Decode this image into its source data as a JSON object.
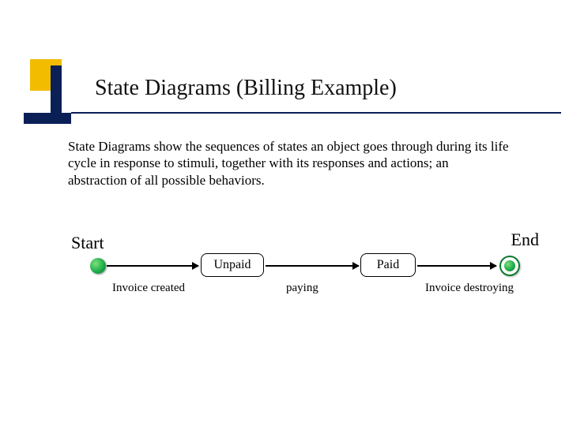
{
  "title": "State Diagrams (Billing Example)",
  "description": "State Diagrams show the sequences of states an object goes through during its life cycle in response to stimuli, together with its responses and actions; an abstraction of all possible behaviors.",
  "diagram": {
    "start_label": "Start",
    "end_label": "End",
    "states": {
      "unpaid": "Unpaid",
      "paid": "Paid"
    },
    "transitions": {
      "t1": "Invoice created",
      "t2": "paying",
      "t3": "Invoice destroying"
    }
  }
}
